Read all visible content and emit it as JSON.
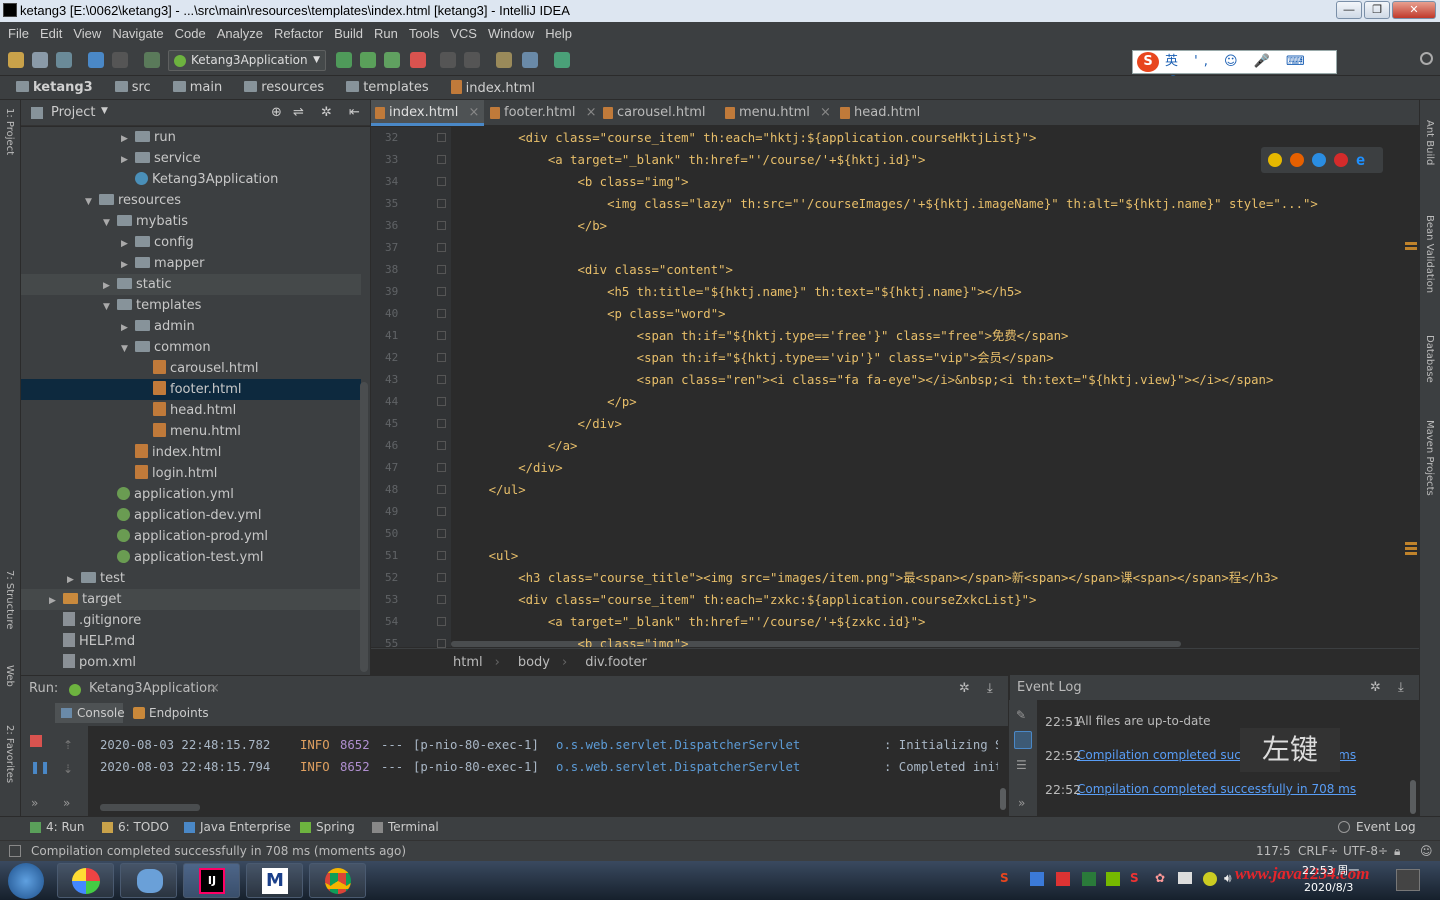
{
  "window": {
    "title": "ketang3 [E:\\0062\\ketang3] - ...\\src\\main\\resources\\templates\\index.html [ketang3] - IntelliJ IDEA"
  },
  "menu": [
    "File",
    "Edit",
    "View",
    "Navigate",
    "Code",
    "Analyze",
    "Refactor",
    "Build",
    "Run",
    "Tools",
    "VCS",
    "Window",
    "Help"
  ],
  "toolbar": {
    "run_config": "Ketang3Application",
    "ime_text": "英 ', ☺ 🎤 ⌨ 👤 👕 ▦"
  },
  "breadcrumbs": [
    "ketang3",
    "src",
    "main",
    "resources",
    "templates",
    "index.html"
  ],
  "project": {
    "header": "Project",
    "items": [
      {
        "label": "run",
        "type": "folder",
        "depth": 5,
        "arrow": "▶"
      },
      {
        "label": "service",
        "type": "folder",
        "depth": 5,
        "arrow": "▶"
      },
      {
        "label": "Ketang3Application",
        "type": "class",
        "depth": 5,
        "arrow": ""
      },
      {
        "label": "resources",
        "type": "folder",
        "depth": 3,
        "arrow": "▼"
      },
      {
        "label": "mybatis",
        "type": "folder",
        "depth": 4,
        "arrow": "▼"
      },
      {
        "label": "config",
        "type": "folder",
        "depth": 5,
        "arrow": "▶"
      },
      {
        "label": "mapper",
        "type": "folder",
        "depth": 5,
        "arrow": "▶"
      },
      {
        "label": "static",
        "type": "folder",
        "depth": 4,
        "arrow": "▶"
      },
      {
        "label": "templates",
        "type": "folder",
        "depth": 4,
        "arrow": "▼"
      },
      {
        "label": "admin",
        "type": "folder",
        "depth": 5,
        "arrow": "▶"
      },
      {
        "label": "common",
        "type": "folder",
        "depth": 5,
        "arrow": "▼"
      },
      {
        "label": "carousel.html",
        "type": "html",
        "depth": 6,
        "arrow": ""
      },
      {
        "label": "footer.html",
        "type": "html",
        "depth": 6,
        "arrow": "",
        "selected": true
      },
      {
        "label": "head.html",
        "type": "html",
        "depth": 6,
        "arrow": ""
      },
      {
        "label": "menu.html",
        "type": "html",
        "depth": 6,
        "arrow": ""
      },
      {
        "label": "index.html",
        "type": "html",
        "depth": 5,
        "arrow": ""
      },
      {
        "label": "login.html",
        "type": "html",
        "depth": 5,
        "arrow": ""
      },
      {
        "label": "application.yml",
        "type": "yml",
        "depth": 4,
        "arrow": ""
      },
      {
        "label": "application-dev.yml",
        "type": "yml",
        "depth": 4,
        "arrow": ""
      },
      {
        "label": "application-prod.yml",
        "type": "yml",
        "depth": 4,
        "arrow": ""
      },
      {
        "label": "application-test.yml",
        "type": "yml",
        "depth": 4,
        "arrow": ""
      },
      {
        "label": "test",
        "type": "folder",
        "depth": 2,
        "arrow": "▶"
      },
      {
        "label": "target",
        "type": "folder-orange",
        "depth": 1,
        "arrow": "▶"
      },
      {
        "label": ".gitignore",
        "type": "gen",
        "depth": 1,
        "arrow": ""
      },
      {
        "label": "HELP.md",
        "type": "gen",
        "depth": 1,
        "arrow": ""
      },
      {
        "label": "pom.xml",
        "type": "gen",
        "depth": 1,
        "arrow": ""
      }
    ]
  },
  "tabs": [
    "index.html",
    "footer.html",
    "carousel.html",
    "menu.html",
    "head.html"
  ],
  "code": {
    "line_numbers": [
      "32",
      "33",
      "34",
      "35",
      "36",
      "37",
      "38",
      "39",
      "40",
      "41",
      "42",
      "43",
      "44",
      "45",
      "46",
      "47",
      "48",
      "49",
      "50",
      "51",
      "52",
      "53",
      "54",
      "55"
    ],
    "lines": [
      "        <div class=\"course_item\" th:each=\"hktj:${application.courseHktjList}\">",
      "            <a target=\"_blank\" th:href=\"'/course/'+${hktj.id}\">",
      "                <b class=\"img\">",
      "                    <img class=\"lazy\" th:src=\"'/courseImages/'+${hktj.imageName}\" th:alt=\"${hktj.name}\" style=\"...\">",
      "                </b>",
      "",
      "                <div class=\"content\">",
      "                    <h5 th:title=\"${hktj.name}\" th:text=\"${hktj.name}\"></h5>",
      "                    <p class=\"word\">",
      "                        <span th:if=\"${hktj.type=='free'}\" class=\"free\">免费</span>",
      "                        <span th:if=\"${hktj.type=='vip'}\" class=\"vip\">会员</span>",
      "                        <span class=\"ren\"><i class=\"fa fa-eye\"></i>&nbsp;<i th:text=\"${hktj.view}\"></i></span>",
      "                    </p>",
      "                </div>",
      "            </a>",
      "        </div>",
      "    </ul>",
      "",
      "",
      "    <ul>",
      "        <h3 class=\"course_title\"><img src=\"images/item.png\">最<span></span>新<span></span>课<span></span>程</h3>",
      "        <div class=\"course_item\" th:each=\"zxkc:${application.courseZxkcList}\">",
      "            <a target=\"_blank\" th:href=\"'/course/'+${zxkc.id}\">",
      "                <b class=\"img\">"
    ]
  },
  "editor_breadcrumb": [
    "html",
    "body",
    "div.footer"
  ],
  "run": {
    "label": "Run:",
    "config": "Ketang3Application",
    "tabs": [
      "Console",
      "Endpoints"
    ],
    "lines": [
      {
        "time": "2020-08-03 22:48:15.782",
        "level": "INFO",
        "pid": "8652",
        "sep": "---",
        "thread": "[p-nio-80-exec-1]",
        "logger": "o.s.web.servlet.DispatcherServlet",
        "msg": ": Initializing S"
      },
      {
        "time": "2020-08-03 22:48:15.794",
        "level": "INFO",
        "pid": "8652",
        "sep": "---",
        "thread": "[p-nio-80-exec-1]",
        "logger": "o.s.web.servlet.DispatcherServlet",
        "msg": ": Completed init"
      }
    ]
  },
  "event_log": {
    "title": "Event Log",
    "entries": [
      {
        "time": "22:51",
        "text": "All files are up-to-date",
        "link": false
      },
      {
        "time": "22:52",
        "text": "Compilation completed successfully in 708 ms",
        "link": true
      },
      {
        "time": "22:52",
        "text": "Compilation completed successfully in 708 ms",
        "link": true
      }
    ],
    "overlay": "左键"
  },
  "bottom_tabs": [
    "4: Run",
    "6: TODO",
    "Java Enterprise",
    "Spring",
    "Terminal"
  ],
  "bottom_right_tab": "Event Log",
  "status": {
    "message": "Compilation completed successfully in 708 ms (moments ago)",
    "position": "117:5",
    "line_sep": "CRLF÷",
    "encoding": "UTF-8÷"
  },
  "right_tools": [
    "Ant Build",
    "Bean Validation",
    "Database",
    "Maven Projects"
  ],
  "left_tools": [
    "1: Project",
    "7: Structure",
    "Web",
    "2: Favorites"
  ],
  "taskbar": {
    "time": "22:53 周一",
    "date": "2020/8/3",
    "watermark": "www.java1234.com"
  },
  "colors": {
    "accent": "#4a88c7",
    "tag": "#e8bf6a",
    "string": "#a5c261",
    "link": "#589df6"
  }
}
